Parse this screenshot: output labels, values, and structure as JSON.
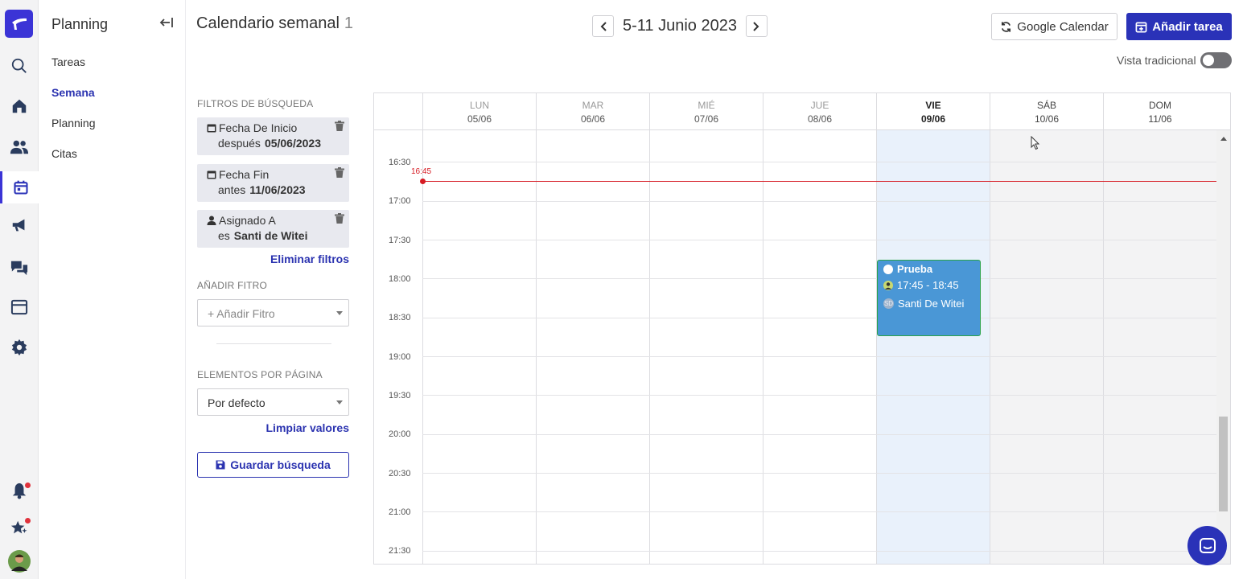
{
  "sidebar": {
    "icons": [
      "logo-icon",
      "search-icon",
      "home-icon",
      "users-icon",
      "calendar-icon",
      "megaphone-icon",
      "chat-icon",
      "browser-icon",
      "gear-icon",
      "bell-icon",
      "star-icon",
      "avatar"
    ]
  },
  "subnav": {
    "title": "Planning",
    "items": [
      {
        "label": "Tareas",
        "active": false
      },
      {
        "label": "Semana",
        "active": true
      },
      {
        "label": "Planning",
        "active": false
      },
      {
        "label": "Citas",
        "active": false
      }
    ]
  },
  "header": {
    "title": "Calendario semanal",
    "count": "1",
    "week_label": "5-11 Junio 2023",
    "google_calendar_label": "Google Calendar",
    "add_task_label": "Añadir tarea",
    "traditional_view_label": "Vista tradicional",
    "traditional_view_on": false
  },
  "filters": {
    "section_label": "FILTROS DE BÚSQUEDA",
    "chips": [
      {
        "field": "Fecha De Inicio",
        "op": "después",
        "value": "05/06/2023",
        "icon": "calendar-icon"
      },
      {
        "field": "Fecha Fin",
        "op": "antes",
        "value": "11/06/2023",
        "icon": "calendar-icon"
      },
      {
        "field": "Asignado A",
        "op": "es",
        "value": "Santi de Witei",
        "icon": "user-icon"
      }
    ],
    "clear_filters_label": "Eliminar filtros",
    "add_filter_section": "AÑADIR FITRO",
    "add_filter_placeholder": "+ Añadir Fitro",
    "per_page_section": "ELEMENTOS POR PÁGINA",
    "per_page_value": "Por defecto",
    "clear_values_label": "Limpiar valores",
    "save_search_label": "Guardar búsqueda"
  },
  "calendar": {
    "days": [
      {
        "name": "LUN",
        "date": "05/06",
        "state": "past"
      },
      {
        "name": "MAR",
        "date": "06/06",
        "state": "past"
      },
      {
        "name": "MIÉ",
        "date": "07/06",
        "state": "past"
      },
      {
        "name": "JUE",
        "date": "08/06",
        "state": "past"
      },
      {
        "name": "VIE",
        "date": "09/06",
        "state": "today"
      },
      {
        "name": "SÁB",
        "date": "10/06",
        "state": "future"
      },
      {
        "name": "DOM",
        "date": "11/06",
        "state": "future"
      }
    ],
    "times": [
      "16:30",
      "17:00",
      "17:30",
      "18:00",
      "18:30",
      "19:00",
      "19:30",
      "20:00",
      "20:30",
      "21:00",
      "21:30"
    ],
    "now_label": "16:45",
    "event": {
      "title": "Prueba",
      "time": "17:45 - 18:45",
      "assignee_initials": "SD",
      "assignee": "Santi De Witei",
      "day": "VIE"
    }
  },
  "colors": {
    "accent": "#2a32b8",
    "event_bg": "#4a97d6",
    "event_border": "#2aa34a",
    "now_line": "#d61b23",
    "today_col": "#e9f1fb"
  }
}
